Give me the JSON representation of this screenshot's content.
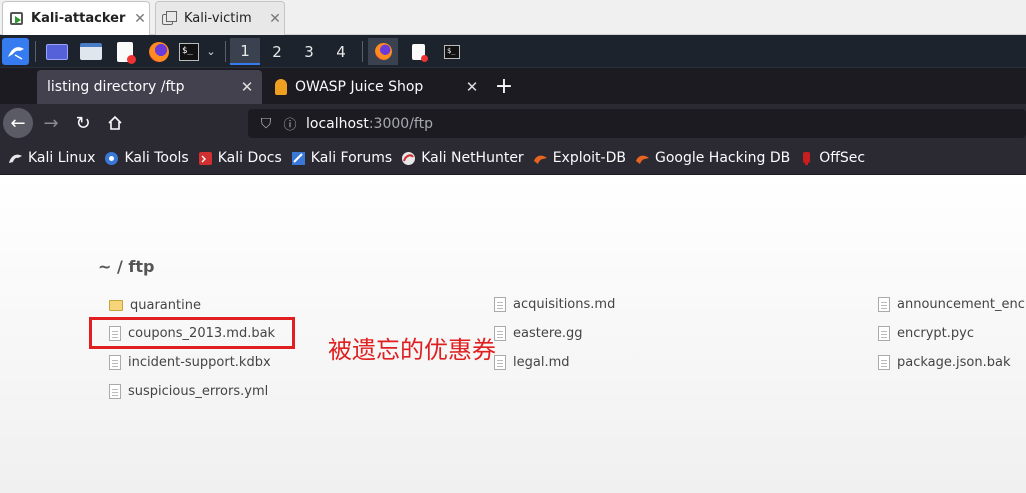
{
  "vm_tabs": [
    {
      "label": "Kali-attacker"
    },
    {
      "label": "Kali-victim"
    }
  ],
  "panel": {
    "workspaces": [
      "1",
      "2",
      "3",
      "4"
    ],
    "active_workspace": "1"
  },
  "browser": {
    "tabs": [
      {
        "title": "listing directory /ftp"
      },
      {
        "title": "OWASP Juice Shop"
      }
    ],
    "url": {
      "host": "localhost",
      "rest": ":3000/ftp"
    },
    "bookmarks": [
      {
        "label": "Kali Linux",
        "icon": "kali-dragon-icon"
      },
      {
        "label": "Kali Tools",
        "icon": "kali-tools-icon"
      },
      {
        "label": "Kali Docs",
        "icon": "kali-docs-icon"
      },
      {
        "label": "Kali Forums",
        "icon": "kali-forums-icon"
      },
      {
        "label": "Kali NetHunter",
        "icon": "nethunter-icon"
      },
      {
        "label": "Exploit-DB",
        "icon": "exploitdb-icon"
      },
      {
        "label": "Google Hacking DB",
        "icon": "ghdb-icon"
      },
      {
        "label": "OffSec",
        "icon": "offsec-icon"
      }
    ]
  },
  "page": {
    "heading": "~ / ftp",
    "files": [
      {
        "name": "quarantine",
        "type": "folder"
      },
      {
        "name": "acquisitions.md",
        "type": "file"
      },
      {
        "name": "announcement_encryp",
        "type": "file"
      },
      {
        "name": "coupons_2013.md.bak",
        "type": "file"
      },
      {
        "name": "eastere.gg",
        "type": "file"
      },
      {
        "name": "encrypt.pyc",
        "type": "file"
      },
      {
        "name": "incident-support.kdbx",
        "type": "file"
      },
      {
        "name": "legal.md",
        "type": "file"
      },
      {
        "name": "package.json.bak",
        "type": "file"
      },
      {
        "name": "suspicious_errors.yml",
        "type": "file"
      }
    ],
    "annotation": "被遗忘的优惠券"
  }
}
